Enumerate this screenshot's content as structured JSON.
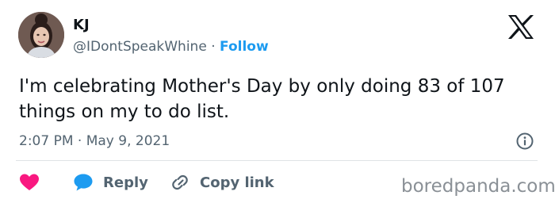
{
  "author": {
    "display_name": "KJ",
    "handle": "@IDontSpeakWhine",
    "separator": "·",
    "follow_label": "Follow"
  },
  "tweet": {
    "text": "I'm celebrating Mother's Day by only doing 83 of 107 things on my to do list.",
    "time": "2:07 PM",
    "date_separator": "·",
    "date": "May 9, 2021"
  },
  "actions": {
    "reply_label": "Reply",
    "copy_link_label": "Copy link"
  },
  "watermark": "boredpanda.com",
  "icons": {
    "brand": "x-logo-icon",
    "info": "info-icon",
    "like": "heart-icon",
    "reply": "speech-bubble-icon",
    "copy_link": "link-icon"
  },
  "colors": {
    "follow": "#1d9bf0",
    "heart": "#f91880",
    "reply_bubble": "#1d9bf0",
    "secondary_text": "#536471"
  }
}
